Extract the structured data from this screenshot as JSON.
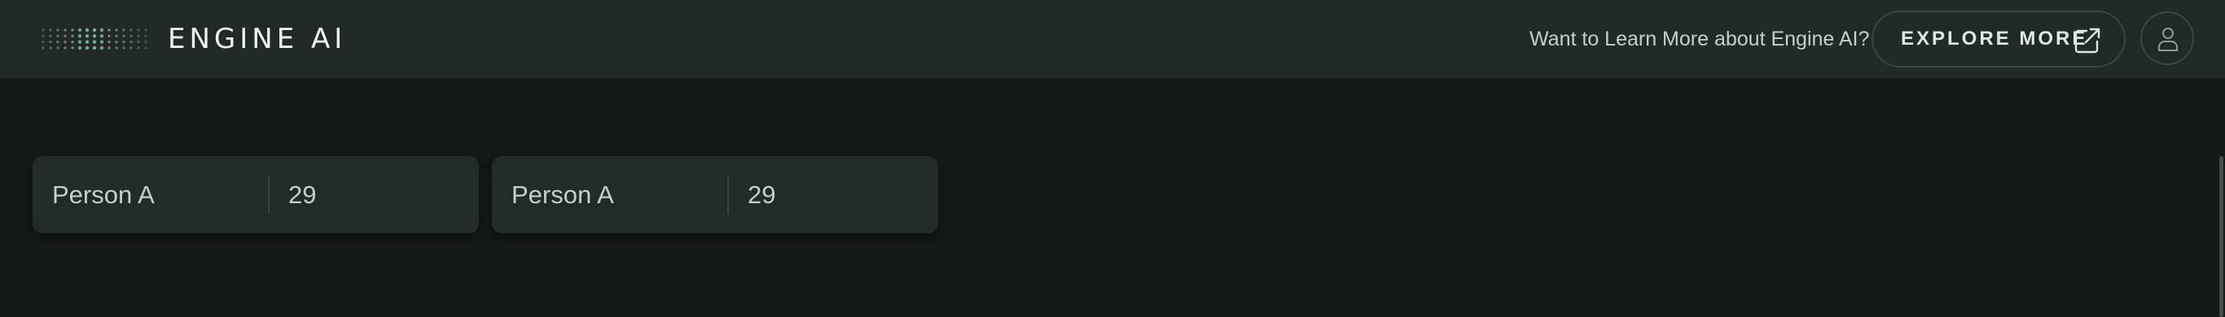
{
  "header": {
    "brand": "ENGINE AI",
    "learn_more_text": "Want to Learn More about Engine AI?",
    "explore_label": "EXPLORE MORE",
    "explore_icon": "external-link-icon",
    "user_icon": "user-icon"
  },
  "cards": [
    {
      "name": "Person A",
      "value": "29"
    },
    {
      "name": "Person A",
      "value": "29"
    }
  ],
  "colors": {
    "background": "#141a19",
    "header": "#222a29",
    "card": "#232b2a",
    "text": "#c6cecc",
    "accent_dot": "#7fb3a5"
  }
}
